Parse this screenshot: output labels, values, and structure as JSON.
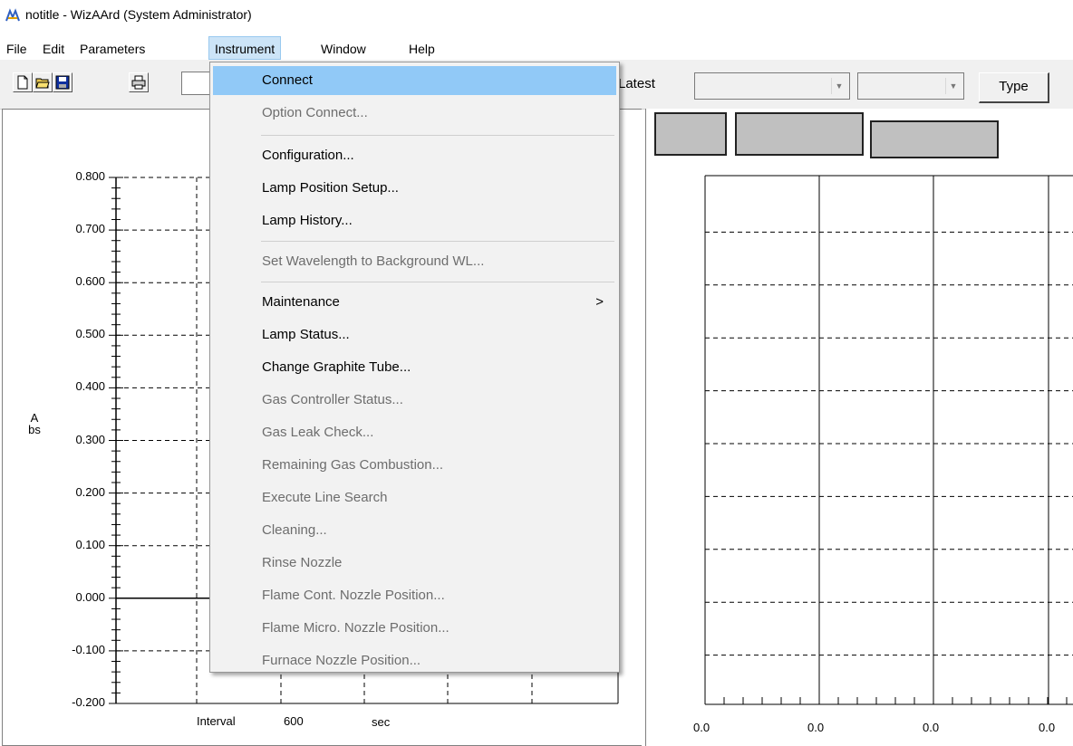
{
  "window": {
    "title": "notitle - WizAArd (System Administrator)",
    "icon": "wizaard-app-icon"
  },
  "menubar": [
    {
      "label": "File"
    },
    {
      "label": "Edit"
    },
    {
      "label": "Parameters"
    },
    {
      "label": "Instrument"
    },
    {
      "label": "Window"
    },
    {
      "label": "Help"
    }
  ],
  "toolbar": {
    "icons": [
      "new-file-icon",
      "open-folder-icon",
      "save-icon",
      "print-icon"
    ],
    "latest_label": "Latest",
    "combo1_value": "",
    "combo2_value": "",
    "type_button": "Type"
  },
  "instrument_menu": {
    "items": [
      {
        "label": "Connect",
        "enabled": true
      },
      {
        "label": "Option Connect...",
        "enabled": false
      },
      {
        "label": "Configuration...",
        "enabled": true
      },
      {
        "label": "Lamp Position Setup...",
        "enabled": true
      },
      {
        "label": "Lamp History...",
        "enabled": true
      },
      {
        "label": "Set Wavelength to Background WL...",
        "enabled": false
      },
      {
        "label": "Maintenance",
        "enabled": true,
        "submenu_arrow": ">"
      },
      {
        "label": "Lamp Status...",
        "enabled": true
      },
      {
        "label": "Change Graphite Tube...",
        "enabled": true
      },
      {
        "label": "Gas Controller Status...",
        "enabled": false
      },
      {
        "label": "Gas Leak Check...",
        "enabled": false
      },
      {
        "label": "Remaining Gas Combustion...",
        "enabled": false
      },
      {
        "label": "Execute Line Search",
        "enabled": false
      },
      {
        "label": "Cleaning...",
        "enabled": false
      },
      {
        "label": "Rinse Nozzle",
        "enabled": false
      },
      {
        "label": "Flame Cont. Nozzle Position...",
        "enabled": false
      },
      {
        "label": "Flame Micro. Nozzle Position...",
        "enabled": false
      },
      {
        "label": "Furnace Nozzle Position...",
        "enabled": false
      }
    ]
  },
  "left_plot": {
    "ylabel": "Abs",
    "y_ticks": [
      "0.800",
      "0.700",
      "0.600",
      "0.500",
      "0.400",
      "0.300",
      "0.200",
      "0.100",
      "0.000",
      "-0.100",
      "-0.200"
    ],
    "interval_label": "Interval",
    "interval_value": "600",
    "interval_unit": "sec"
  },
  "right_plot": {
    "x_ticks": [
      "0.0",
      "0.0",
      "0.0",
      "0.0"
    ]
  },
  "colors": {
    "highlight": "#91c9f7",
    "menu_bg": "#f2f2f2",
    "toolbar_bg": "#f0f0f0",
    "tab_gray": "#c0c0c0"
  }
}
